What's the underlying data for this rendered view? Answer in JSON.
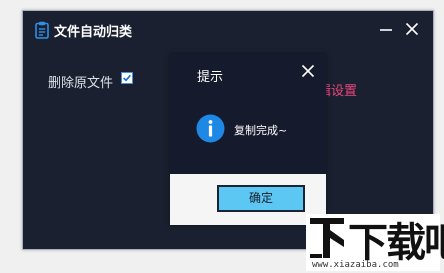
{
  "app": {
    "title": "文件自动归类",
    "delete_original_label": "删除原文件",
    "delete_original_checked": true,
    "edit_settings_label": "编辑设置"
  },
  "dialog": {
    "title": "提示",
    "message": "复制完成~",
    "ok_label": "确定"
  },
  "watermark": {
    "text": "下载吧",
    "url": "www.xiazaiba.com"
  },
  "colors": {
    "window_bg": "#1b2030",
    "dialog_bg": "#151b2c",
    "accent_pink": "#e9457c",
    "button_blue": "#5bc7f2",
    "info_blue": "#1e88e5"
  },
  "icons": [
    "clipboard-icon",
    "minimize-icon",
    "close-icon",
    "checkbox-checked-icon",
    "info-icon"
  ]
}
